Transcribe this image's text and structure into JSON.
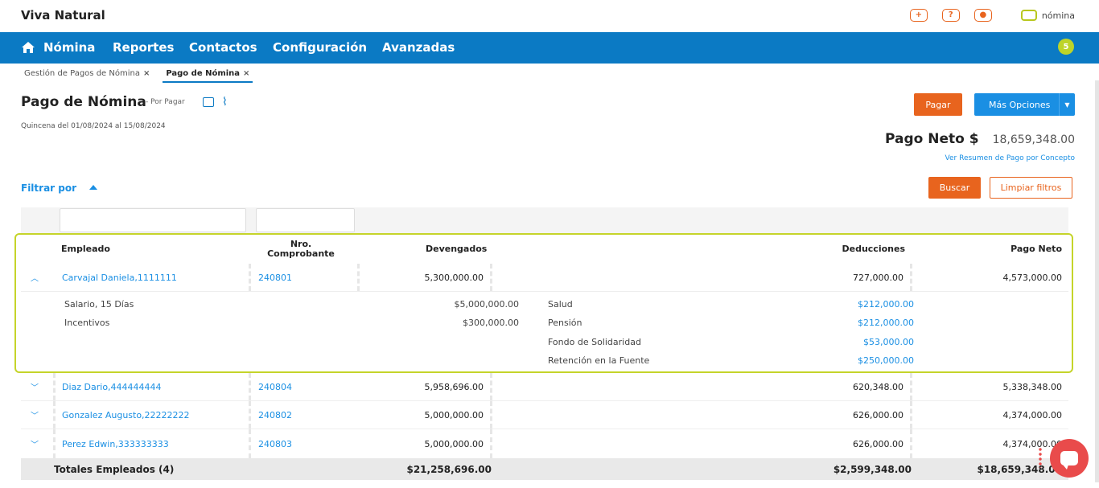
{
  "app": {
    "brand": "Viva Natural",
    "product_logo_text": "nómina"
  },
  "top_icons": [
    "add-icon",
    "help-icon",
    "user-icon"
  ],
  "nav": {
    "items": [
      "Nómina",
      "Reportes",
      "Contactos",
      "Configuración",
      "Avanzadas"
    ],
    "badge": "5"
  },
  "tabs": [
    {
      "label": "Gestión de Pagos de Nómina",
      "close": "×"
    },
    {
      "label": "Pago de Nómina",
      "close": "×"
    }
  ],
  "page": {
    "title": "Pago de Nómina",
    "status": "- Por Pagar",
    "subtitle": "Quincena del 01/08/2024 al 15/08/2024",
    "pagar_label": "Pagar",
    "mas_label": "Más Opciones",
    "neto_label": "Pago Neto $",
    "neto_value": "18,659,348.00",
    "neto_link": "Ver Resumen de Pago por Concepto",
    "filtrar_label": "Filtrar por",
    "buscar_label": "Buscar",
    "limpiar_label": "Limpiar filtros"
  },
  "table": {
    "headers": {
      "empleado": "Empleado",
      "comprobante": "Nro. Comprobante",
      "devengados": "Devengados",
      "deducciones": "Deducciones",
      "neto": "Pago Neto"
    },
    "rows": [
      {
        "empleado": "Carvajal Daniela,1111111",
        "comprobante": "240801",
        "devengados": "5,300,000.00",
        "deducciones": "727,000.00",
        "neto": "4,573,000.00",
        "expanded": true
      },
      {
        "empleado": "Diaz Dario,444444444",
        "comprobante": "240804",
        "devengados": "5,958,696.00",
        "deducciones": "620,348.00",
        "neto": "5,338,348.00",
        "expanded": false
      },
      {
        "empleado": "Gonzalez Augusto,22222222",
        "comprobante": "240802",
        "devengados": "5,000,000.00",
        "deducciones": "626,000.00",
        "neto": "4,374,000.00",
        "expanded": false
      },
      {
        "empleado": "Perez Edwin,333333333",
        "comprobante": "240803",
        "devengados": "5,000,000.00",
        "deducciones": "626,000.00",
        "neto": "4,374,000.00",
        "expanded": false
      }
    ],
    "detail": {
      "devengados": [
        {
          "concepto": "Salario, 15 Días",
          "valor": "$5,000,000.00"
        },
        {
          "concepto": "Incentivos",
          "valor": "$300,000.00"
        }
      ],
      "deducciones": [
        {
          "concepto": "Salud",
          "valor": "$212,000.00"
        },
        {
          "concepto": "Pensión",
          "valor": "$212,000.00"
        },
        {
          "concepto": "Fondo de Solidaridad",
          "valor": "$53,000.00"
        },
        {
          "concepto": "Retención en la Fuente",
          "valor": "$250,000.00"
        }
      ]
    },
    "totals": {
      "label": "Totales Empleados (4)",
      "devengados": "$21,258,696.00",
      "deducciones": "$2,599,348.00",
      "neto": "$18,659,348.00"
    }
  },
  "colors": {
    "nav": "#0b7ac4",
    "accent_orange": "#e8641e",
    "accent_blue": "#1a8fe3",
    "highlight": "#c5d42a"
  }
}
